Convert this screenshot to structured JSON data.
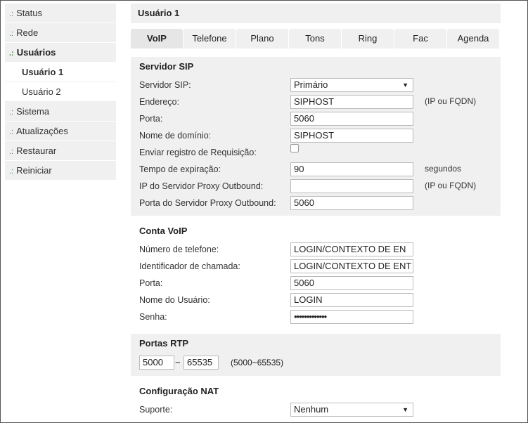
{
  "sidebar": {
    "items": [
      {
        "label": "Status"
      },
      {
        "label": "Rede"
      },
      {
        "label": "Usuários"
      },
      {
        "label": "Usuário 1"
      },
      {
        "label": "Usuário 2"
      },
      {
        "label": "Sistema"
      },
      {
        "label": "Atualizações"
      },
      {
        "label": "Restaurar"
      },
      {
        "label": "Reiniciar"
      }
    ],
    "bullet": ".:"
  },
  "page": {
    "title": "Usuário 1"
  },
  "tabs": [
    {
      "label": "VoIP"
    },
    {
      "label": "Telefone"
    },
    {
      "label": "Plano"
    },
    {
      "label": "Tons"
    },
    {
      "label": "Ring"
    },
    {
      "label": "Fac"
    },
    {
      "label": "Agenda"
    }
  ],
  "sip": {
    "title": "Servidor SIP",
    "server_label": "Servidor SIP:",
    "server_value": "Primário",
    "address_label": "Endereço:",
    "address_value": "SIPHOST",
    "address_note": "(IP ou FQDN)",
    "port_label": "Porta:",
    "port_value": "5060",
    "domain_label": "Nome de domínio:",
    "domain_value": "SIPHOST",
    "register_label": "Enviar registro de Requisição:",
    "expire_label": "Tempo de expiração:",
    "expire_value": "90",
    "expire_note": "segundos",
    "proxy_ip_label": "IP do Servidor Proxy Outbound:",
    "proxy_ip_value": "",
    "proxy_ip_note": "(IP ou FQDN)",
    "proxy_port_label": "Porta do Servidor Proxy Outbound:",
    "proxy_port_value": "5060"
  },
  "voip": {
    "title": "Conta VoIP",
    "phone_label": "Número de telefone:",
    "phone_value": "LOGIN/CONTEXTO DE EN",
    "callerid_label": "Identificador de chamada:",
    "callerid_value": "LOGIN/CONTEXTO DE ENT",
    "port_label": "Porta:",
    "port_value": "5060",
    "user_label": "Nome do Usuário:",
    "user_value": "LOGIN",
    "password_label": "Senha:",
    "password_value": "•••••••••••••"
  },
  "rtp": {
    "title": "Portas RTP",
    "start_value": "5000",
    "separator": "~",
    "end_value": "65535",
    "note": "(5000~65535)"
  },
  "nat": {
    "title": "Configuração NAT",
    "support_label": "Suporte:",
    "support_value": "Nenhum"
  }
}
